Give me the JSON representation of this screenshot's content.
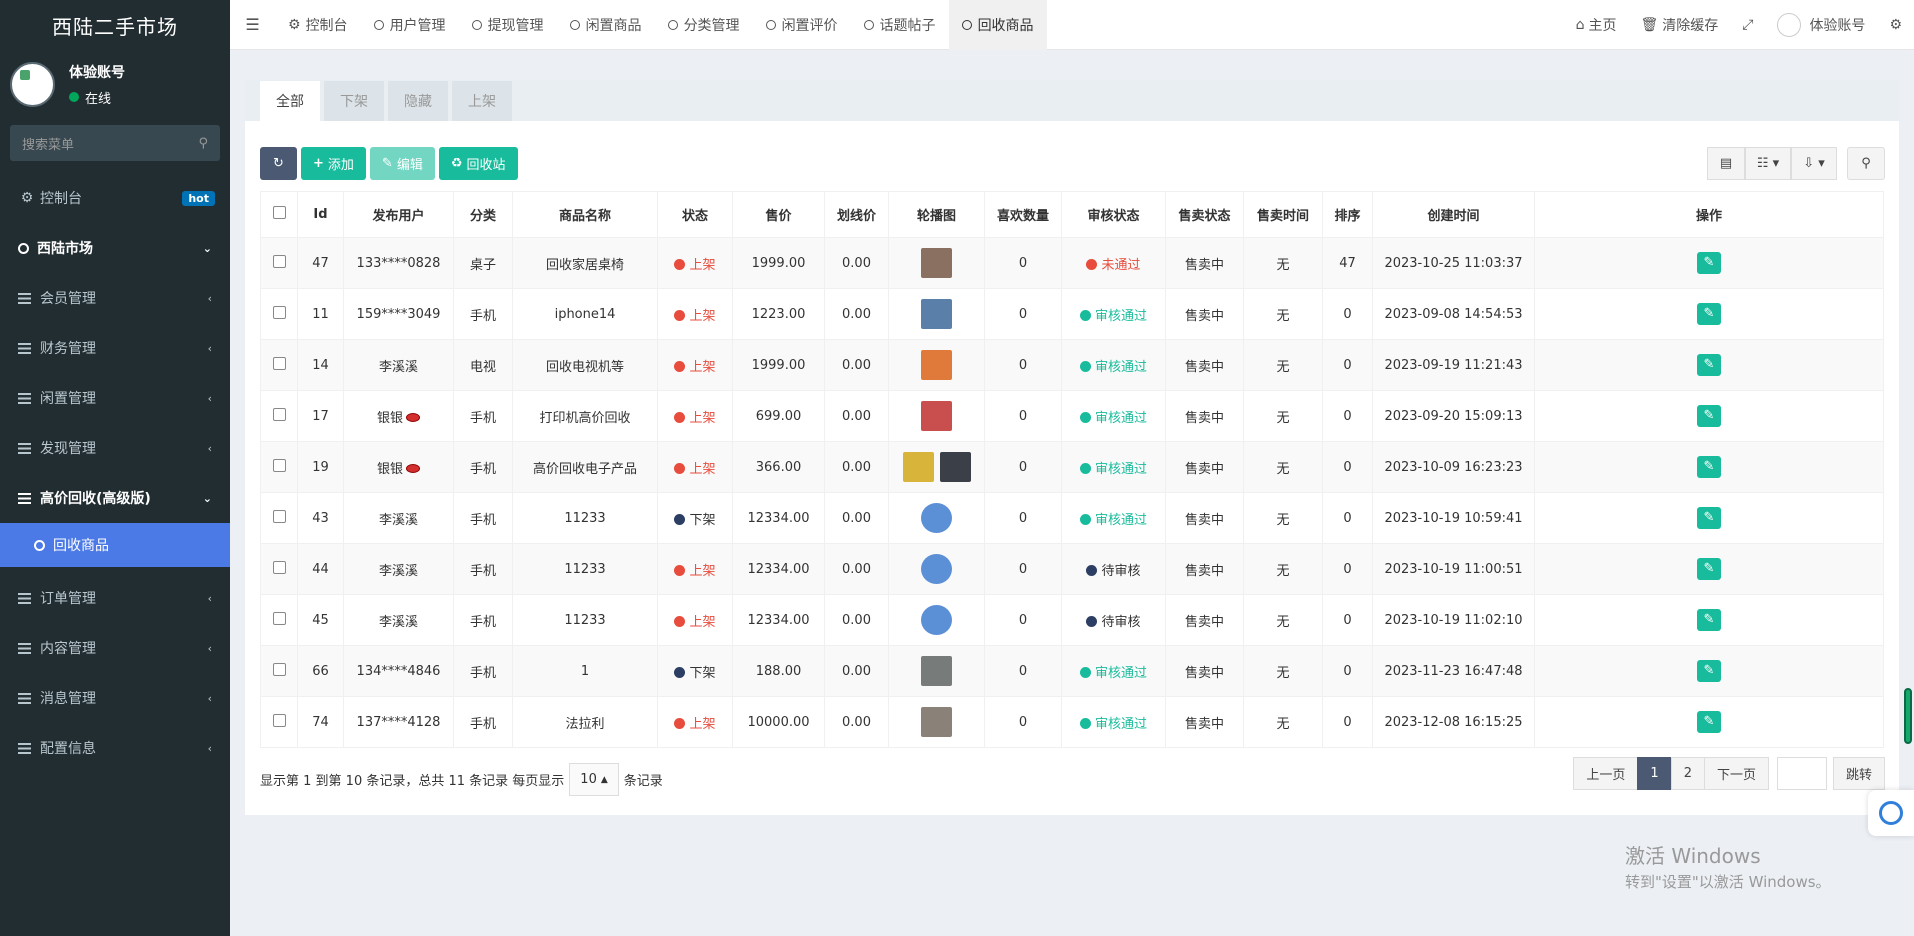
{
  "sidebar": {
    "brand": "西陆二手市场",
    "user_name": "体验账号",
    "user_status": "在线",
    "search_placeholder": "搜索菜单",
    "items": {
      "dashboard": "控制台",
      "dashboard_badge": "hot",
      "market": "西陆市场",
      "members": "会员管理",
      "finance": "财务管理",
      "idle": "闲置管理",
      "discover": "发现管理",
      "recycle_pro": "高价回收(高级版)",
      "recycle_goods": "回收商品",
      "orders": "订单管理",
      "content": "内容管理",
      "messages": "消息管理",
      "config": "配置信息"
    }
  },
  "topbar": {
    "tabs": [
      "控制台",
      "用户管理",
      "提现管理",
      "闲置商品",
      "分类管理",
      "闲置评价",
      "话题帖子",
      "回收商品"
    ],
    "home": "主页",
    "clear_cache": "清除缓存",
    "account": "体验账号"
  },
  "status_tabs": [
    "全部",
    "下架",
    "隐藏",
    "上架"
  ],
  "toolbar": {
    "add": "添加",
    "edit": "编辑",
    "recycle_bin": "回收站"
  },
  "table": {
    "headers": [
      "Id",
      "发布用户",
      "分类",
      "商品名称",
      "状态",
      "售价",
      "划线价",
      "轮播图",
      "喜欢数量",
      "审核状态",
      "售卖状态",
      "售卖时间",
      "排序",
      "创建时间",
      "操作"
    ],
    "rows": [
      {
        "id": "47",
        "user": "133****0828",
        "lips": false,
        "cat": "桌子",
        "name": "回收家居桌椅",
        "status": "上架",
        "status_color": "red",
        "price": "1999.00",
        "orig": "0.00",
        "likes": "0",
        "audit": "未通过",
        "audit_color": "red",
        "sale": "售卖中",
        "sale_time": "无",
        "sort": "47",
        "created": "2023-10-25 11:03:37",
        "thumbs": [
          "#8a7060"
        ]
      },
      {
        "id": "11",
        "user": "159****3049",
        "lips": false,
        "cat": "手机",
        "name": "iphone14",
        "status": "上架",
        "status_color": "red",
        "price": "1223.00",
        "orig": "0.00",
        "likes": "0",
        "audit": "审核通过",
        "audit_color": "teal",
        "sale": "售卖中",
        "sale_time": "无",
        "sort": "0",
        "created": "2023-09-08 14:54:53",
        "thumbs": [
          "#5a7fa8"
        ]
      },
      {
        "id": "14",
        "user": "李溪溪",
        "lips": false,
        "cat": "电视",
        "name": "回收电视机等",
        "status": "上架",
        "status_color": "red",
        "price": "1999.00",
        "orig": "0.00",
        "likes": "0",
        "audit": "审核通过",
        "audit_color": "teal",
        "sale": "售卖中",
        "sale_time": "无",
        "sort": "0",
        "created": "2023-09-19 11:21:43",
        "thumbs": [
          "#e07a3a"
        ]
      },
      {
        "id": "17",
        "user": "银银",
        "lips": true,
        "cat": "手机",
        "name": "打印机高价回收",
        "status": "上架",
        "status_color": "red",
        "price": "699.00",
        "orig": "0.00",
        "likes": "0",
        "audit": "审核通过",
        "audit_color": "teal",
        "sale": "售卖中",
        "sale_time": "无",
        "sort": "0",
        "created": "2023-09-20 15:09:13",
        "thumbs": [
          "#c94f4f"
        ]
      },
      {
        "id": "19",
        "user": "银银",
        "lips": true,
        "cat": "手机",
        "name": "高价回收电子产品",
        "status": "上架",
        "status_color": "red",
        "price": "366.00",
        "orig": "0.00",
        "likes": "0",
        "audit": "审核通过",
        "audit_color": "teal",
        "sale": "售卖中",
        "sale_time": "无",
        "sort": "0",
        "created": "2023-10-09 16:23:23",
        "thumbs": [
          "#d9b43a",
          "#3a3f48"
        ]
      },
      {
        "id": "43",
        "user": "李溪溪",
        "lips": false,
        "cat": "手机",
        "name": "11233",
        "status": "下架",
        "status_color": "navy",
        "price": "12334.00",
        "orig": "0.00",
        "likes": "0",
        "audit": "审核通过",
        "audit_color": "teal",
        "sale": "售卖中",
        "sale_time": "无",
        "sort": "0",
        "created": "2023-10-19 10:59:41",
        "thumbs": [
          "#5b8fd6"
        ],
        "round": true
      },
      {
        "id": "44",
        "user": "李溪溪",
        "lips": false,
        "cat": "手机",
        "name": "11233",
        "status": "上架",
        "status_color": "red",
        "price": "12334.00",
        "orig": "0.00",
        "likes": "0",
        "audit": "待审核",
        "audit_color": "navy",
        "sale": "售卖中",
        "sale_time": "无",
        "sort": "0",
        "created": "2023-10-19 11:00:51",
        "thumbs": [
          "#5b8fd6"
        ],
        "round": true
      },
      {
        "id": "45",
        "user": "李溪溪",
        "lips": false,
        "cat": "手机",
        "name": "11233",
        "status": "上架",
        "status_color": "red",
        "price": "12334.00",
        "orig": "0.00",
        "likes": "0",
        "audit": "待审核",
        "audit_color": "navy",
        "sale": "售卖中",
        "sale_time": "无",
        "sort": "0",
        "created": "2023-10-19 11:02:10",
        "thumbs": [
          "#5b8fd6"
        ],
        "round": true
      },
      {
        "id": "66",
        "user": "134****4846",
        "lips": false,
        "cat": "手机",
        "name": "1",
        "status": "下架",
        "status_color": "navy",
        "price": "188.00",
        "orig": "0.00",
        "likes": "0",
        "audit": "审核通过",
        "audit_color": "teal",
        "sale": "售卖中",
        "sale_time": "无",
        "sort": "0",
        "created": "2023-11-23 16:47:48",
        "thumbs": [
          "#777b7a"
        ]
      },
      {
        "id": "74",
        "user": "137****4128",
        "lips": false,
        "cat": "手机",
        "name": "法拉利",
        "status": "上架",
        "status_color": "red",
        "price": "10000.00",
        "orig": "0.00",
        "likes": "0",
        "audit": "审核通过",
        "audit_color": "teal",
        "sale": "售卖中",
        "sale_time": "无",
        "sort": "0",
        "created": "2023-12-08 16:15:25",
        "thumbs": [
          "#8a8178"
        ]
      }
    ]
  },
  "footer": {
    "info_prefix": "显示第 1 到第 10 条记录，总共 11 条记录 每页显示",
    "page_size": "10",
    "info_suffix": "条记录",
    "prev": "上一页",
    "pages": [
      "1",
      "2"
    ],
    "next": "下一页",
    "go": "跳转"
  },
  "watermark": {
    "line1": "激活 Windows",
    "line2": "转到\"设置\"以激活 Windows。"
  }
}
